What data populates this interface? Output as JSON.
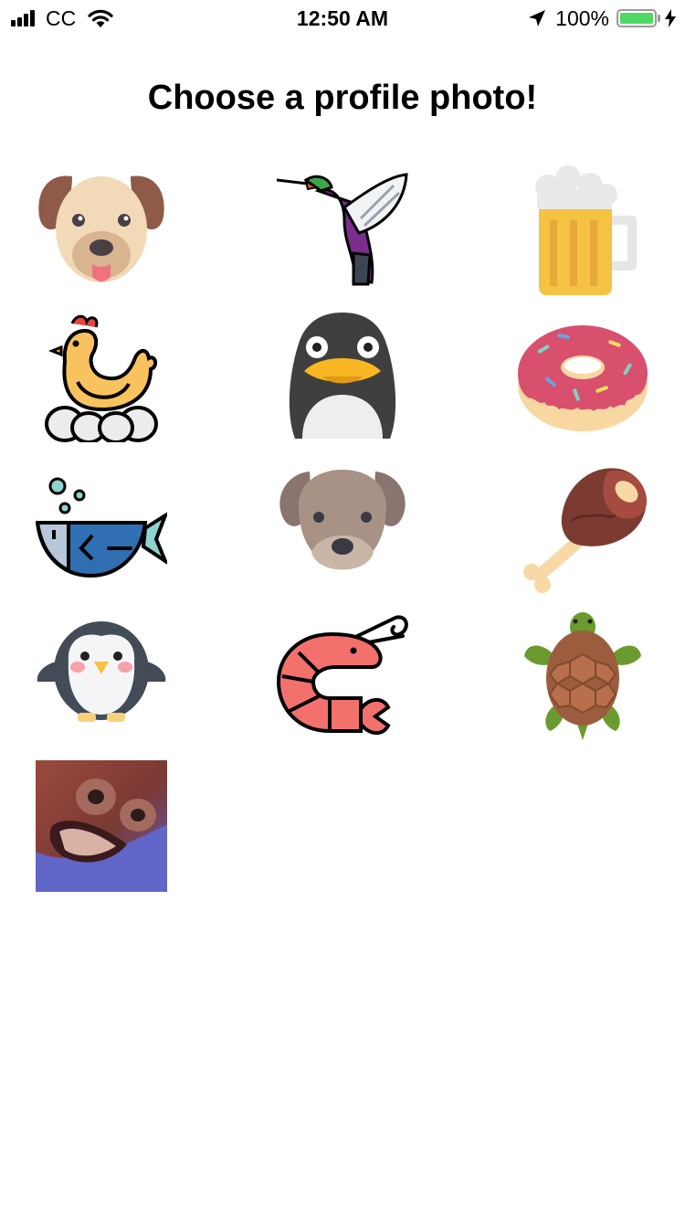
{
  "status_bar": {
    "carrier": "CC",
    "time": "12:50 AM",
    "battery_percent": "100%",
    "battery_level": 1.0,
    "battery_color": "#4cd964"
  },
  "page": {
    "title": "Choose a profile photo!"
  },
  "avatars": [
    {
      "icon": "dog-face-icon"
    },
    {
      "icon": "hummingbird-icon"
    },
    {
      "icon": "beer-mug-icon"
    },
    {
      "icon": "hen-with-eggs-icon"
    },
    {
      "icon": "penguin-icon"
    },
    {
      "icon": "donut-icon"
    },
    {
      "icon": "fish-icon"
    },
    {
      "icon": "brown-dog-icon"
    },
    {
      "icon": "meat-drumstick-icon"
    },
    {
      "icon": "baby-penguin-icon"
    },
    {
      "icon": "shrimp-icon"
    },
    {
      "icon": "turtle-icon"
    },
    {
      "icon": "custom-photo-icon"
    }
  ]
}
